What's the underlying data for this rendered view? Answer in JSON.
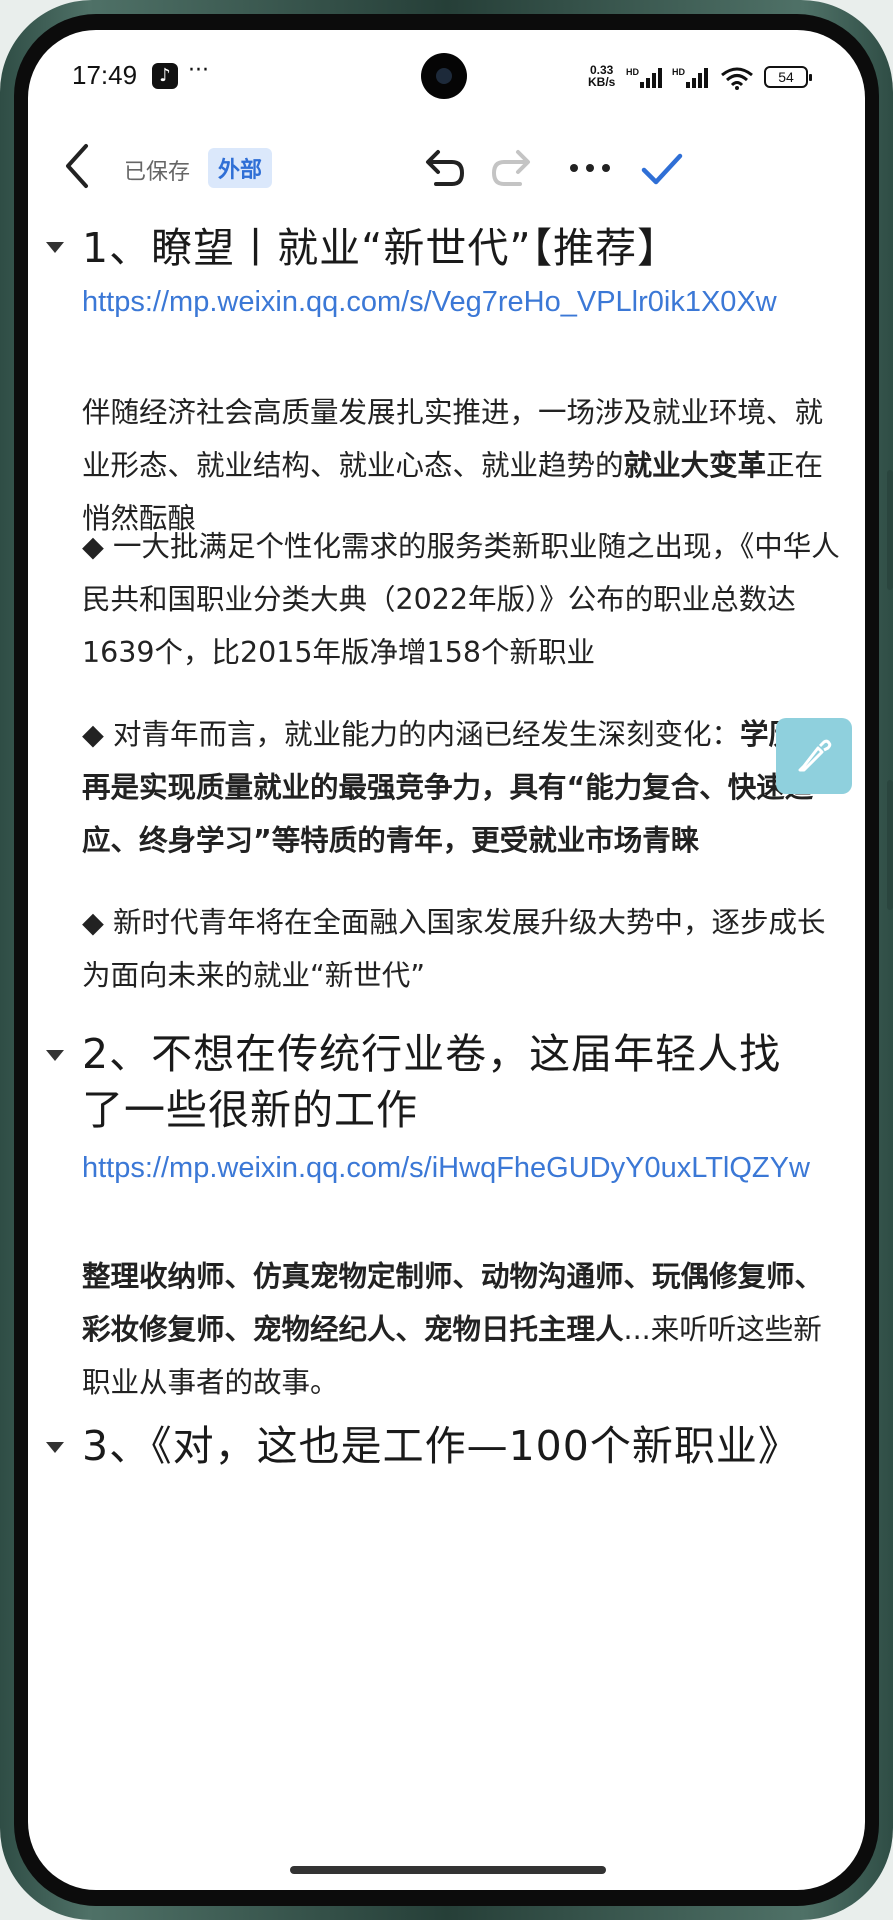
{
  "status_bar": {
    "time": "17:49",
    "app_icon": "tiktok-icon",
    "more": "···",
    "net_speed_value": "0.33",
    "net_speed_unit": "KB/s",
    "hd1": "HD",
    "hd2": "HD",
    "battery": "54"
  },
  "toolbar": {
    "saved_label": "已保存",
    "tag_label": "外部",
    "icons": [
      "back-icon",
      "undo-icon",
      "redo-icon",
      "more-icon",
      "check-icon"
    ]
  },
  "sections": [
    {
      "heading": "1、瞭望丨就业“新世代”【推荐】",
      "link": "https://mp.weixin.qq.com/s/Veg7reHo_VPLlr0ik1X0Xw",
      "p1_a": "伴随经济社会高质量发展扎实推进，一场涉及就业环境、就业形态、就业结构、就业心态、就业趋势的",
      "p1_b": "就业大变革",
      "p1_c": "正在悄然酝酿",
      "p2": "◆ 一大批满足个性化需求的服务类新职业随之出现，《中华人民共和国职业分类大典（2022年版）》公布的职业总数达1639个，比2015年版净增158个新职业",
      "p3_a": "◆ 对青年而言，就业能力的内涵已经发生深刻变化：",
      "p3_b": "学历不再是实现质量就业的最强竞争力，具有“能力复合、快速适应、终身学习”等特质的青年，更受就业市场青睐",
      "p4": "◆ 新时代青年将在全面融入国家发展升级大势中，逐步成长为面向未来的就业“新世代”"
    },
    {
      "heading": "2、不想在传统行业卷，这届年轻人找了一些很新的工作",
      "link": "https://mp.weixin.qq.com/s/iHwqFheGUDyY0uxLTlQZYw",
      "p1_a": "整理收纳师、仿真宠物定制师、动物沟通师、玩偶修复师、彩妆修复师、宠物经纪人、宠物日托主理人",
      "p1_b": "...来听听这些新职业从事者的故事。"
    },
    {
      "heading": "3、《对，这也是工作—100个新职业》"
    }
  ],
  "floating_button": "pen-icon"
}
